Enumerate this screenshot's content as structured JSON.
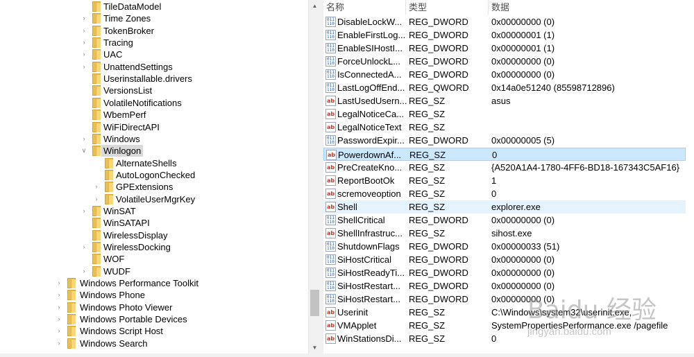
{
  "tree": {
    "items": [
      {
        "label": "TileDataModel",
        "level": 1,
        "expander": false
      },
      {
        "label": "Time Zones",
        "level": 1,
        "expander": true
      },
      {
        "label": "TokenBroker",
        "level": 1,
        "expander": true
      },
      {
        "label": "Tracing",
        "level": 1,
        "expander": true
      },
      {
        "label": "UAC",
        "level": 1,
        "expander": true
      },
      {
        "label": "UnattendSettings",
        "level": 1,
        "expander": true
      },
      {
        "label": "Userinstallable.drivers",
        "level": 1,
        "expander": false
      },
      {
        "label": "VersionsList",
        "level": 1,
        "expander": false
      },
      {
        "label": "VolatileNotifications",
        "level": 1,
        "expander": false
      },
      {
        "label": "WbemPerf",
        "level": 1,
        "expander": false
      },
      {
        "label": "WiFiDirectAPI",
        "level": 1,
        "expander": false
      },
      {
        "label": "Windows",
        "level": 1,
        "expander": true
      },
      {
        "label": "Winlogon",
        "level": 1,
        "expander": "open",
        "selected": true
      },
      {
        "label": "AlternateShells",
        "level": 2,
        "expander": false
      },
      {
        "label": "AutoLogonChecked",
        "level": 2,
        "expander": false
      },
      {
        "label": "GPExtensions",
        "level": 2,
        "expander": true
      },
      {
        "label": "VolatileUserMgrKey",
        "level": 2,
        "expander": true
      },
      {
        "label": "WinSAT",
        "level": 1,
        "expander": true
      },
      {
        "label": "WinSATAPI",
        "level": 1,
        "expander": false
      },
      {
        "label": "WirelessDisplay",
        "level": 1,
        "expander": false
      },
      {
        "label": "WirelessDocking",
        "level": 1,
        "expander": true
      },
      {
        "label": "WOF",
        "level": 1,
        "expander": false
      },
      {
        "label": "WUDF",
        "level": 1,
        "expander": true
      },
      {
        "label": "Windows Performance Toolkit",
        "level": 0,
        "expander": true
      },
      {
        "label": "Windows Phone",
        "level": 0,
        "expander": true
      },
      {
        "label": "Windows Photo Viewer",
        "level": 0,
        "expander": true
      },
      {
        "label": "Windows Portable Devices",
        "level": 0,
        "expander": true
      },
      {
        "label": "Windows Script Host",
        "level": 0,
        "expander": true
      },
      {
        "label": "Windows Search",
        "level": 0,
        "expander": true
      }
    ]
  },
  "list": {
    "columns": {
      "name": "名称",
      "type": "类型",
      "data": "数据"
    },
    "rows": [
      {
        "name": "DisableLockW...",
        "type": "REG_DWORD",
        "data": "0x00000000 (0)",
        "icon": "binary-value-icon"
      },
      {
        "name": "EnableFirstLog...",
        "type": "REG_DWORD",
        "data": "0x00000001 (1)",
        "icon": "binary-value-icon"
      },
      {
        "name": "EnableSIHostI...",
        "type": "REG_DWORD",
        "data": "0x00000001 (1)",
        "icon": "binary-value-icon"
      },
      {
        "name": "ForceUnlockL...",
        "type": "REG_DWORD",
        "data": "0x00000000 (0)",
        "icon": "binary-value-icon"
      },
      {
        "name": "IsConnectedA...",
        "type": "REG_DWORD",
        "data": "0x00000000 (0)",
        "icon": "binary-value-icon"
      },
      {
        "name": "LastLogOffEnd...",
        "type": "REG_QWORD",
        "data": "0x14a0e51240 (85598712896)",
        "icon": "binary-value-icon"
      },
      {
        "name": "LastUsedUsern...",
        "type": "REG_SZ",
        "data": "asus",
        "icon": "string-value-icon"
      },
      {
        "name": "LegalNoticeCa...",
        "type": "REG_SZ",
        "data": "",
        "icon": "string-value-icon"
      },
      {
        "name": "LegalNoticeText",
        "type": "REG_SZ",
        "data": "",
        "icon": "string-value-icon"
      },
      {
        "name": "PasswordExpir...",
        "type": "REG_DWORD",
        "data": "0x00000005 (5)",
        "icon": "binary-value-icon"
      },
      {
        "name": "PowerdownAf...",
        "type": "REG_SZ",
        "data": "0",
        "icon": "string-value-icon",
        "state": "selected"
      },
      {
        "name": "PreCreateKno...",
        "type": "REG_SZ",
        "data": "{A520A1A4-1780-4FF6-BD18-167343C5AF16}",
        "icon": "string-value-icon"
      },
      {
        "name": "ReportBootOk",
        "type": "REG_SZ",
        "data": "1",
        "icon": "string-value-icon"
      },
      {
        "name": "scremoveoption",
        "type": "REG_SZ",
        "data": "0",
        "icon": "string-value-icon"
      },
      {
        "name": "Shell",
        "type": "REG_SZ",
        "data": "explorer.exe",
        "icon": "string-value-icon",
        "state": "hover"
      },
      {
        "name": "ShellCritical",
        "type": "REG_DWORD",
        "data": "0x00000000 (0)",
        "icon": "binary-value-icon"
      },
      {
        "name": "ShellInfrastruc...",
        "type": "REG_SZ",
        "data": "sihost.exe",
        "icon": "string-value-icon"
      },
      {
        "name": "ShutdownFlags",
        "type": "REG_DWORD",
        "data": "0x00000033 (51)",
        "icon": "binary-value-icon"
      },
      {
        "name": "SiHostCritical",
        "type": "REG_DWORD",
        "data": "0x00000000 (0)",
        "icon": "binary-value-icon"
      },
      {
        "name": "SiHostReadyTi...",
        "type": "REG_DWORD",
        "data": "0x00000000 (0)",
        "icon": "binary-value-icon"
      },
      {
        "name": "SiHostRestart...",
        "type": "REG_DWORD",
        "data": "0x00000000 (0)",
        "icon": "binary-value-icon"
      },
      {
        "name": "SiHostRestart...",
        "type": "REG_DWORD",
        "data": "0x00000000 (0)",
        "icon": "binary-value-icon"
      },
      {
        "name": "Userinit",
        "type": "REG_SZ",
        "data": "C:\\Windows\\system32\\userinit.exe,",
        "icon": "string-value-icon"
      },
      {
        "name": "VMApplet",
        "type": "REG_SZ",
        "data": "SystemPropertiesPerformance.exe /pagefile",
        "icon": "string-value-icon"
      },
      {
        "name": "WinStationsDi...",
        "type": "REG_SZ",
        "data": "0",
        "icon": "string-value-icon"
      }
    ]
  },
  "watermark": {
    "logo": "Baidu 经验",
    "url": "jingyan.baidu.com"
  }
}
